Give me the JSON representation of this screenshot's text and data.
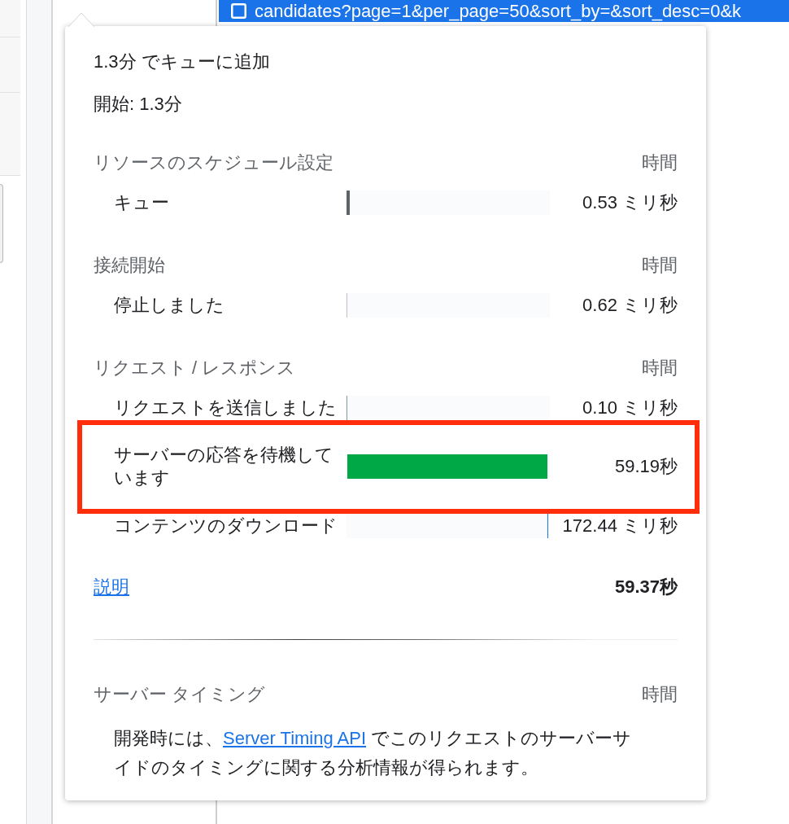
{
  "request_list": {
    "rows": [
      {
        "name": "candidates?page=1&per_page=50&sort_by=&sort_desc=0&k",
        "selected": true
      }
    ]
  },
  "timing_popover": {
    "summary": [
      "1.3分 でキューに追加",
      "開始: 1.3分"
    ],
    "sections": [
      {
        "title": "リソースのスケジュール設定",
        "column": "時間",
        "rows": [
          {
            "label": "キュー",
            "value": "0.53 ミリ秒",
            "color": "#5f6368",
            "level": 0.016,
            "highlighted": false
          }
        ]
      },
      {
        "title": "接続開始",
        "column": "時間",
        "rows": [
          {
            "label": "停止しました",
            "value": "0.62 ミリ秒",
            "color": "#bdc1c6",
            "level": 0.004,
            "highlighted": false
          }
        ]
      },
      {
        "title": "リクエスト / レスポンス",
        "column": "時間",
        "rows": [
          {
            "label": "リクエストを送信しました",
            "value": "0.10 ミリ秒",
            "color": "#7c9aa5",
            "level": 0.004,
            "highlighted": false
          },
          {
            "label": "サーバーの応答を待機しています",
            "value": "59.19秒",
            "color": "#00a846",
            "level": 0.984,
            "highlighted": true
          },
          {
            "label": "コンテンツのダウンロード",
            "value": "172.44 ミリ秒",
            "color": "#1a73e8",
            "level": 0.004,
            "highlighted": false
          }
        ]
      }
    ],
    "footer": {
      "link": "説明",
      "total": "59.37秒"
    },
    "server_timing": {
      "title": "サーバー タイミング",
      "column": "時間",
      "note": {
        "before": "開発時には、",
        "link": "Server Timing API",
        "after": " でこのリクエストのサーバーサイドのタイミングに関する分析情報が得られます。"
      }
    }
  }
}
